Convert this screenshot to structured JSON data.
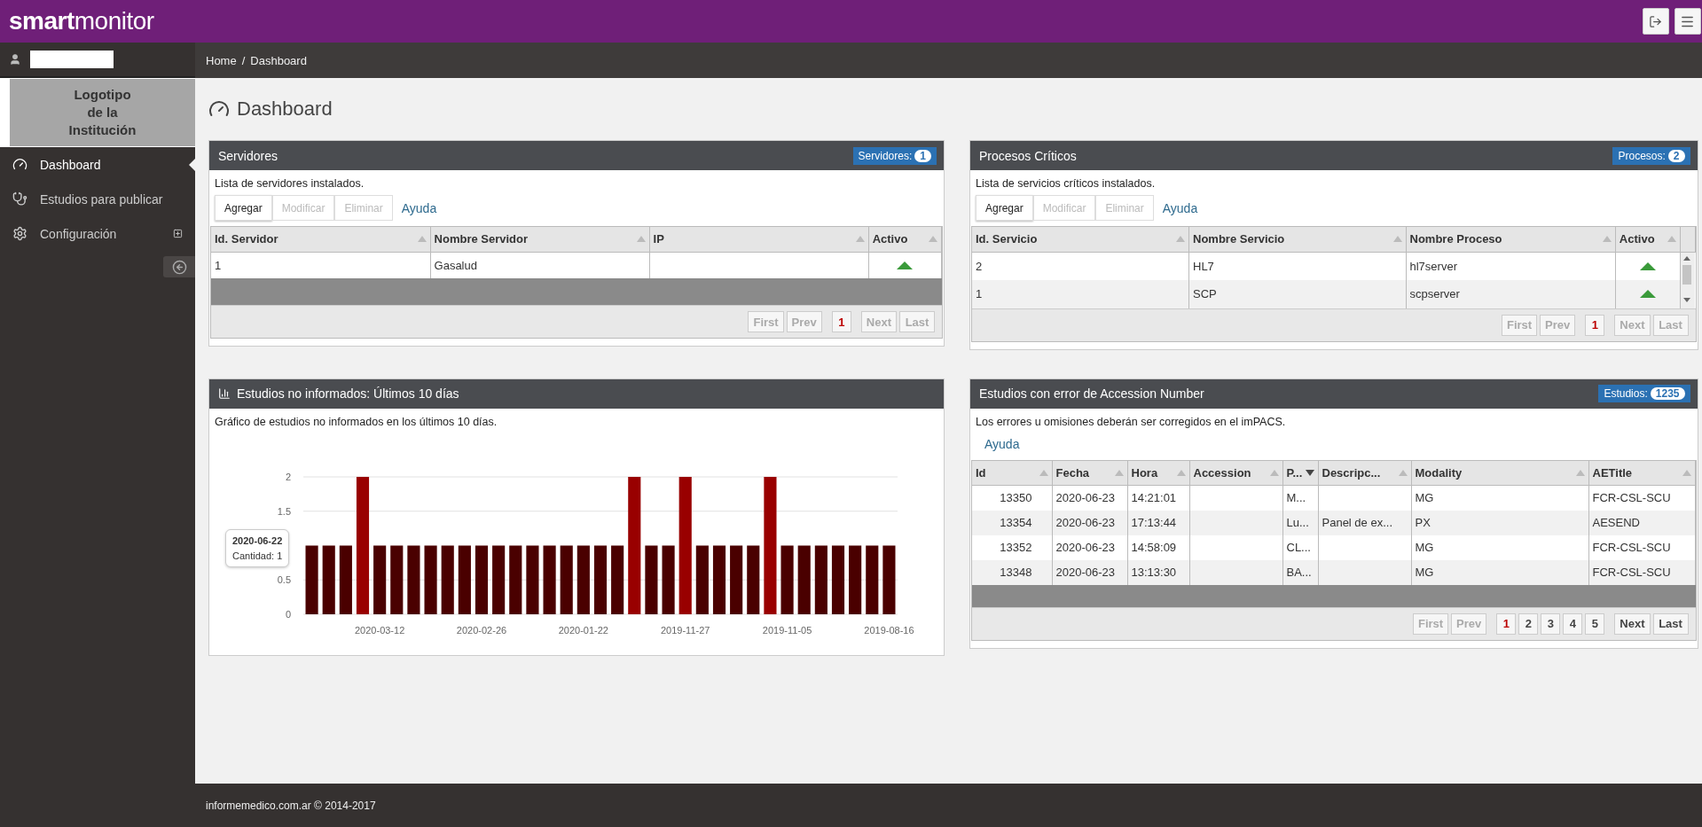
{
  "topbar": {
    "brand_bold": "smart",
    "brand_light": "monitor"
  },
  "sidebar": {
    "logo_lines": [
      "Logotipo",
      "de la",
      "Institución"
    ],
    "items": [
      {
        "label": "Dashboard",
        "selected": true,
        "expandable": false
      },
      {
        "label": "Estudios para publicar",
        "selected": false,
        "expandable": false
      },
      {
        "label": "Configuración",
        "selected": false,
        "expandable": true
      }
    ]
  },
  "breadcrumb": {
    "items": [
      "Home",
      "Dashboard"
    ],
    "separator": "/"
  },
  "page_title": "Dashboard",
  "servers": {
    "title": "Servidores",
    "badge": {
      "label": "Servidores:",
      "count": "1"
    },
    "description": "Lista de servidores instalados.",
    "toolbar": [
      {
        "label": "Agregar",
        "disabled": false
      },
      {
        "label": "Modificar",
        "disabled": true
      },
      {
        "label": "Eliminar",
        "disabled": true
      }
    ],
    "help": "Ayuda",
    "columns": [
      {
        "label": "Id. Servidor",
        "sorted": false
      },
      {
        "label": "Nombre Servidor",
        "sorted": false
      },
      {
        "label": "IP",
        "sorted": false
      },
      {
        "label": "Activo",
        "sorted": false
      }
    ],
    "rows": [
      {
        "cells": [
          "1",
          "Gasalud",
          ""
        ],
        "active": true
      }
    ],
    "pager": [
      {
        "label": "First",
        "disabled": true,
        "selected": false
      },
      {
        "label": "Prev",
        "disabled": true,
        "selected": false
      },
      {
        "label": "1",
        "disabled": false,
        "selected": true
      },
      {
        "label": "Next",
        "disabled": true,
        "selected": false
      },
      {
        "label": "Last",
        "disabled": true,
        "selected": false
      }
    ]
  },
  "processes": {
    "title": "Procesos Críticos",
    "badge": {
      "label": "Procesos:",
      "count": "2"
    },
    "description": "Lista de servicios críticos instalados.",
    "toolbar": [
      {
        "label": "Agregar",
        "disabled": false
      },
      {
        "label": "Modificar",
        "disabled": true
      },
      {
        "label": "Eliminar",
        "disabled": true
      }
    ],
    "help": "Ayuda",
    "columns": [
      {
        "label": "Id. Servicio",
        "sorted": false
      },
      {
        "label": "Nombre Servicio",
        "sorted": false
      },
      {
        "label": "Nombre Proceso",
        "sorted": false
      },
      {
        "label": "Activo",
        "sorted": false
      }
    ],
    "rows": [
      {
        "cells": [
          "2",
          "HL7",
          "hl7server"
        ],
        "active": true
      },
      {
        "cells": [
          "1",
          "SCP",
          "scpserver"
        ],
        "active": true
      }
    ],
    "pager": [
      {
        "label": "First",
        "disabled": true,
        "selected": false
      },
      {
        "label": "Prev",
        "disabled": true,
        "selected": false
      },
      {
        "label": "1",
        "disabled": false,
        "selected": true
      },
      {
        "label": "Next",
        "disabled": true,
        "selected": false
      },
      {
        "label": "Last",
        "disabled": true,
        "selected": false
      }
    ]
  },
  "unreported": {
    "title": "Estudios no informados: Últimos 10 días",
    "description": "Gráfico de estudios no informados en los últimos 10 días.",
    "tooltip": {
      "date": "2020-06-22",
      "text": "Cantidad: 1"
    },
    "chart_data": {
      "type": "bar",
      "ylim": [
        0,
        2
      ],
      "yticks": [
        0,
        0.5,
        1.5,
        2
      ],
      "grid": true,
      "categories": [
        null,
        null,
        null,
        null,
        "2020-03-12",
        null,
        null,
        null,
        null,
        null,
        "2020-02-26",
        null,
        null,
        null,
        null,
        null,
        "2020-01-22",
        null,
        null,
        null,
        null,
        null,
        "2019-11-27",
        null,
        null,
        null,
        null,
        null,
        "2019-11-05",
        null,
        null,
        null,
        null,
        null,
        "2019-08-16"
      ],
      "series": [
        {
          "color": "#4a0000",
          "values": [
            1,
            1,
            1,
            null,
            1,
            1,
            1,
            1,
            1,
            1,
            1,
            1,
            1,
            1,
            1,
            1,
            1,
            1,
            1,
            null,
            1,
            1,
            null,
            1,
            1,
            1,
            1,
            null,
            1,
            1,
            1,
            1,
            1,
            1,
            1
          ]
        },
        {
          "color": "#990000",
          "values": [
            null,
            null,
            null,
            2,
            null,
            null,
            null,
            null,
            null,
            null,
            null,
            null,
            null,
            null,
            null,
            null,
            null,
            null,
            null,
            2,
            null,
            null,
            2,
            null,
            null,
            null,
            null,
            2,
            null,
            null,
            null,
            null,
            null,
            null,
            null
          ]
        }
      ]
    }
  },
  "accession": {
    "title": "Estudios con error de Accession Number",
    "badge": {
      "label": "Estudios:",
      "count": "1235"
    },
    "description": "Los errores u omisiones deberán ser corregidos en el imPACS.",
    "help": "Ayuda",
    "columns": [
      {
        "label": "Id",
        "sorted": false
      },
      {
        "label": "Fecha",
        "sorted": false
      },
      {
        "label": "Hora",
        "sorted": false
      },
      {
        "label": "Accession",
        "sorted": false
      },
      {
        "label": "P...",
        "sorted": true
      },
      {
        "label": "Descripc...",
        "sorted": false
      },
      {
        "label": "Modality",
        "sorted": false
      },
      {
        "label": "AETitle",
        "sorted": false
      }
    ],
    "rows": [
      [
        "13350",
        "2020-06-23",
        "14:21:01",
        "",
        "M...",
        "",
        "MG",
        "FCR-CSL-SCU"
      ],
      [
        "13354",
        "2020-06-23",
        "17:13:44",
        "",
        "Lu...",
        "Panel de ex...",
        "PX",
        "AESEND"
      ],
      [
        "13352",
        "2020-06-23",
        "14:58:09",
        "",
        "CL...",
        "",
        "MG",
        "FCR-CSL-SCU"
      ],
      [
        "13348",
        "2020-06-23",
        "13:13:30",
        "",
        "BA...",
        "",
        "MG",
        "FCR-CSL-SCU"
      ]
    ],
    "pager": [
      {
        "label": "First",
        "disabled": true,
        "selected": false
      },
      {
        "label": "Prev",
        "disabled": true,
        "selected": false
      },
      {
        "label": "1",
        "disabled": false,
        "selected": true
      },
      {
        "label": "2",
        "disabled": false,
        "selected": false
      },
      {
        "label": "3",
        "disabled": false,
        "selected": false
      },
      {
        "label": "4",
        "disabled": false,
        "selected": false
      },
      {
        "label": "5",
        "disabled": false,
        "selected": false
      },
      {
        "label": "Next",
        "disabled": false,
        "selected": false
      },
      {
        "label": "Last",
        "disabled": false,
        "selected": false
      }
    ]
  },
  "footer": "informemedico.com.ar © 2014-2017"
}
